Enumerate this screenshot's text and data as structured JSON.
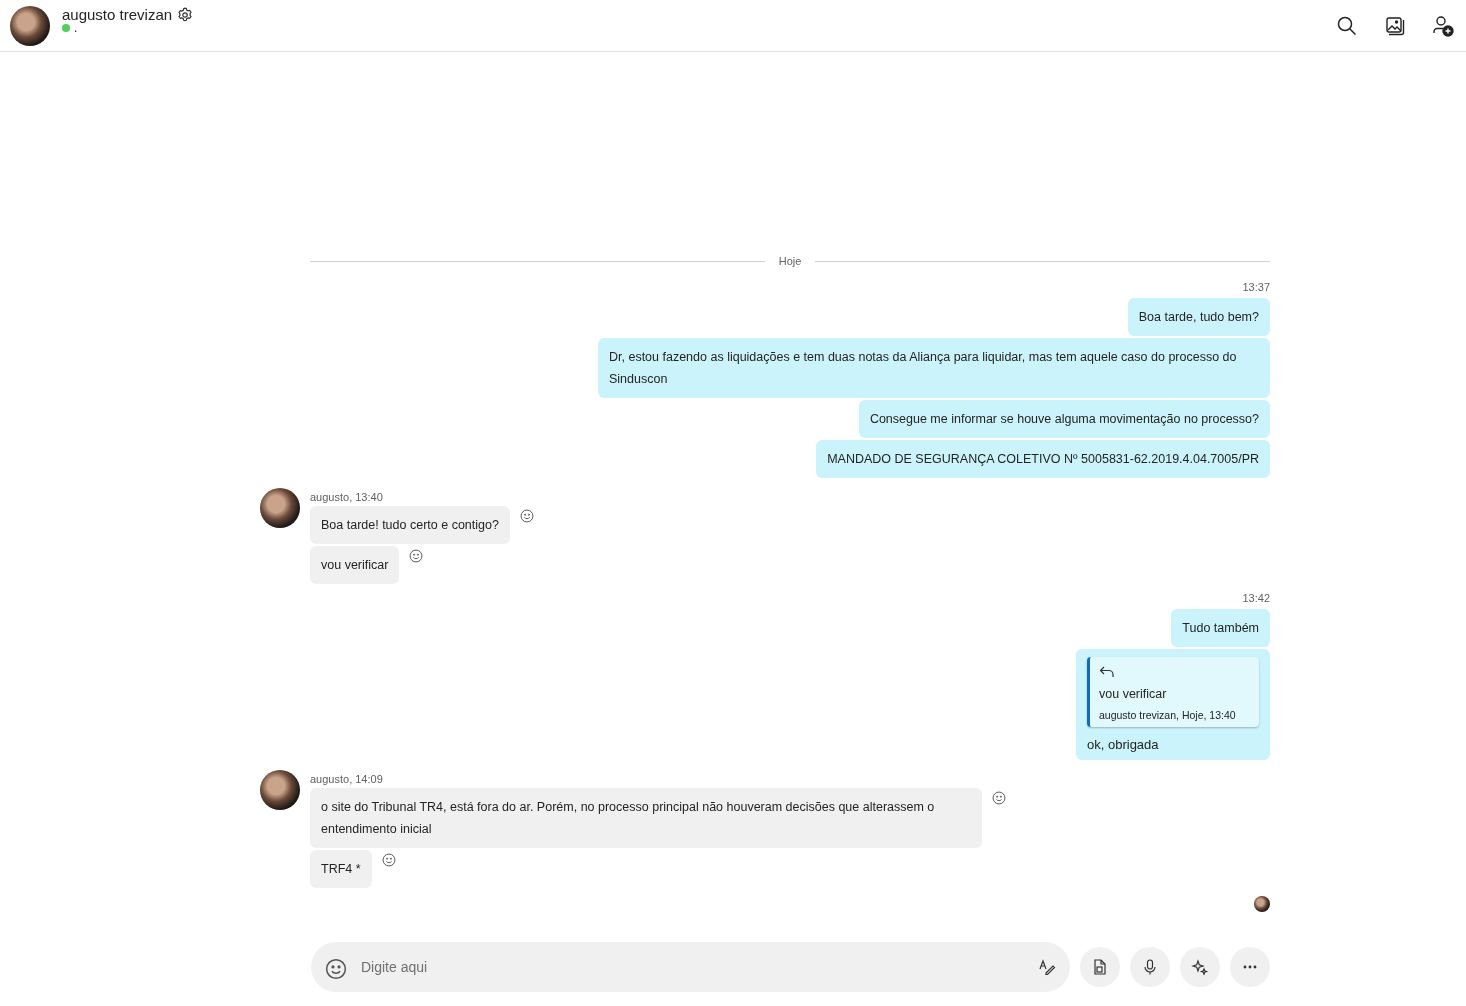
{
  "header": {
    "name": "augusto trevizan",
    "status_text": ".",
    "online": true
  },
  "date_divider": "Hoje",
  "groups": [
    {
      "kind": "outgoing",
      "time": "13:37",
      "messages": [
        {
          "kind": "text",
          "text": "Boa tarde, tudo bem?"
        },
        {
          "kind": "text",
          "text": "Dr, estou fazendo as liquidações e tem duas notas da Aliança para liquidar, mas tem aquele caso do processo do Sinduscon"
        },
        {
          "kind": "text",
          "text": "Consegue me informar se houve alguma movimentação no processo?"
        },
        {
          "kind": "text",
          "text": "MANDADO DE SEGURANÇA COLETIVO Nº 5005831-62.2019.4.04.7005/PR"
        }
      ]
    },
    {
      "kind": "incoming",
      "sender": "augusto, 13:40",
      "messages": [
        {
          "kind": "text",
          "text": "Boa tarde! tudo certo e contigo?"
        },
        {
          "kind": "text",
          "text": "vou verificar"
        }
      ]
    },
    {
      "kind": "outgoing",
      "time": "13:42",
      "messages": [
        {
          "kind": "text",
          "text": "Tudo também"
        },
        {
          "kind": "reply",
          "quote_text": "vou verificar",
          "quote_meta": "augusto trevizan, Hoje, 13:40",
          "text": "ok, obrigada"
        }
      ]
    },
    {
      "kind": "incoming",
      "sender": "augusto, 14:09",
      "messages": [
        {
          "kind": "text",
          "text": "o site do Tribunal TR4, está fora do ar. Porém, no processo principal não houveram decisões que alterassem o entendimento inicial"
        },
        {
          "kind": "text",
          "text": "TRF4 *"
        }
      ]
    }
  ],
  "composer": {
    "placeholder": "Digite aqui"
  }
}
